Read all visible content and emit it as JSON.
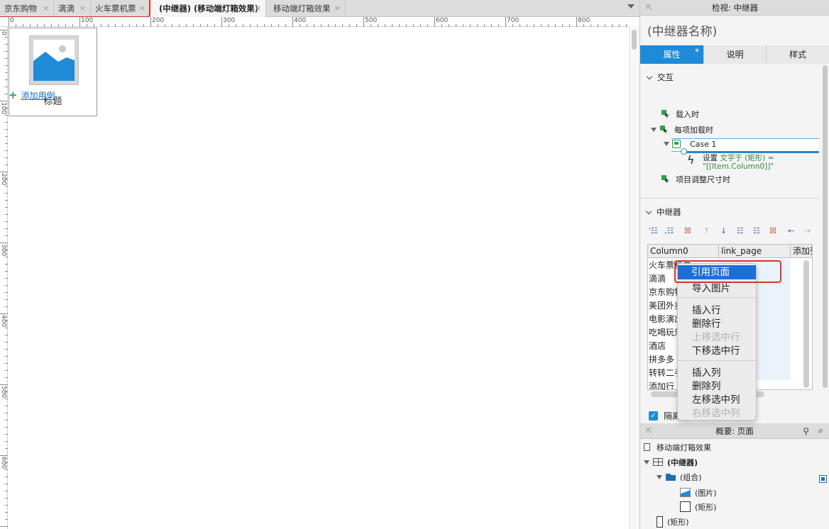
{
  "tabs": [
    {
      "label": "京东购物",
      "close": "×"
    },
    {
      "label": "滴滴",
      "close": "×"
    },
    {
      "label": "火车票机票",
      "close": "×"
    },
    {
      "label": "(中继器) (移动端灯箱效果)",
      "close": "×"
    },
    {
      "label": "移动端灯箱效果",
      "close": "×"
    }
  ],
  "ruler": {
    "top": [
      "0",
      "100",
      "200",
      "300",
      "400",
      "500",
      "600",
      "700",
      "800"
    ],
    "left": [
      "0",
      "100",
      "200",
      "300",
      "400",
      "500",
      "600"
    ]
  },
  "canvas": {
    "item_title": "标题"
  },
  "inspector": {
    "header": "检视: 中继器",
    "widget_name": "(中继器名称)",
    "tabs": [
      "属性",
      "说明",
      "样式"
    ],
    "tab_dot": "*",
    "interaction_title": "交互",
    "add_case": "添加用例",
    "events": {
      "on_load": "载入时",
      "on_item_load": "每项加载时",
      "case": "Case 1",
      "action_prefix": "设置",
      "action_green": "文字于 (矩形) =",
      "action_value": "\"[[Item.Column0]]\"",
      "on_item_resize": "项目调整尺寸时"
    },
    "repeater_title": "中继器",
    "toolbar": [
      "'☷",
      ",☷",
      "☒",
      "↑",
      "↓",
      "☷",
      "☷",
      "☒",
      "←",
      "→"
    ],
    "grid": {
      "headers": [
        "Column0",
        "link_page",
        "添加列"
      ],
      "rows": [
        "火车票机票",
        "滴滴",
        "京东购物",
        "美团外卖",
        "电影演出",
        "吃喝玩乐",
        "酒店",
        "拼多多",
        "转转二手",
        "添加行"
      ]
    },
    "isolate_label": "隔离"
  },
  "context_menu": {
    "items": [
      {
        "label": "引用页面",
        "disabled": false
      },
      {
        "label": "导入图片",
        "disabled": false
      },
      {
        "label": "插入行",
        "disabled": false
      },
      {
        "label": "删除行",
        "disabled": false
      },
      {
        "label": "上移选中行",
        "disabled": true
      },
      {
        "label": "下移选中行",
        "disabled": false
      },
      {
        "label": "插入列",
        "disabled": false
      },
      {
        "label": "删除列",
        "disabled": false
      },
      {
        "label": "左移选中列",
        "disabled": false
      },
      {
        "label": "右移选中列",
        "disabled": true
      }
    ]
  },
  "outline": {
    "header": "概要: 页面",
    "items": [
      "移动端灯箱效果",
      "(中继器)",
      "(组合)",
      "(图片)",
      "(矩形)",
      "(矩形)"
    ]
  },
  "colors": {
    "accent": "#1f8ad8",
    "highlight_red": "#e0312d",
    "menu_selected": "#1d6fd8",
    "interaction_green": "#2ea04a"
  }
}
